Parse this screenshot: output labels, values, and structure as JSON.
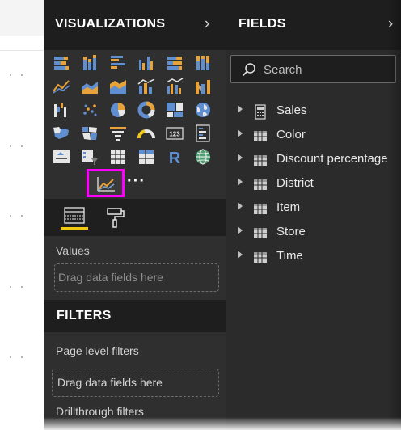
{
  "visualizations": {
    "title": "VISUALIZATIONS",
    "collapse_icon": "chevron-right-icon",
    "icons": [
      "stacked-bar-chart-icon",
      "stacked-column-chart-icon",
      "clustered-bar-chart-icon",
      "clustered-column-chart-icon",
      "100-percent-stacked-bar-chart-icon",
      "100-percent-stacked-column-chart-icon",
      "line-chart-icon",
      "area-chart-icon",
      "stacked-area-chart-icon",
      "line-and-stacked-column-chart-icon",
      "line-and-clustered-column-chart-icon",
      "ribbon-chart-icon",
      "waterfall-chart-icon",
      "scatter-chart-icon",
      "pie-chart-icon",
      "donut-chart-icon",
      "treemap-icon",
      "map-icon",
      "filled-map-icon",
      "shape-map-icon",
      "funnel-icon",
      "gauge-icon",
      "card-icon",
      "multi-row-card-icon",
      "kpi-icon",
      "slicer-icon",
      "table-icon",
      "matrix-icon",
      "r-script-visual-icon",
      "arcgis-map-icon"
    ],
    "selected_icon": "custom-line-chart-icon",
    "more_label": "···",
    "tabs": [
      "fields-tab-icon",
      "format-paint-roller-icon"
    ],
    "values_label": "Values",
    "values_drop_placeholder": "Drag data fields here",
    "accent_color": "#f2c811",
    "selection_color": "#ff00ff"
  },
  "filters": {
    "title": "FILTERS",
    "page_level_label": "Page level filters",
    "drop_placeholder": "Drag data fields here",
    "drillthrough_label": "Drillthrough filters"
  },
  "fields": {
    "title": "FIELDS",
    "collapse_icon": "chevron-right-icon",
    "search_placeholder": "Search",
    "items": [
      {
        "label": "Sales",
        "icon": "calculator-icon"
      },
      {
        "label": "Color",
        "icon": "table-icon"
      },
      {
        "label": "Discount percentage",
        "icon": "table-icon"
      },
      {
        "label": "District",
        "icon": "table-icon"
      },
      {
        "label": "Item",
        "icon": "table-icon"
      },
      {
        "label": "Store",
        "icon": "table-icon"
      },
      {
        "label": "Time",
        "icon": "table-icon"
      }
    ]
  }
}
